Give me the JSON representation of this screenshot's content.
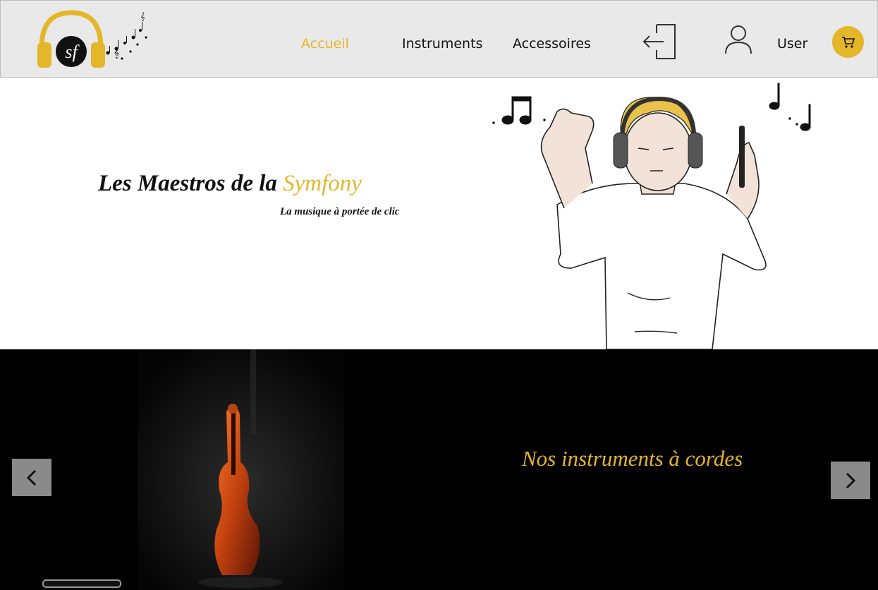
{
  "brand": {
    "logo_text": "sf",
    "logo_icon": "headphones-music-icon"
  },
  "nav": {
    "items": [
      {
        "label": "Accueil",
        "active": true
      },
      {
        "label": "Instruments",
        "active": false
      },
      {
        "label": "Accessoires",
        "active": false
      }
    ],
    "logout_icon": "logout-door-icon",
    "user_icon": "user-icon",
    "user_label": "User",
    "cart_icon": "cart-icon"
  },
  "hero": {
    "title_main": "Les Maestros de la ",
    "title_accent": "Symfony",
    "subtitle": "La musique à portée de clic",
    "illustration": "man-listening-headphones-illustration"
  },
  "carousel": {
    "slide_title": "Nos instruments à cordes",
    "slide_image": "double-bass-photo",
    "prev_icon": "chevron-left-icon",
    "next_icon": "chevron-right-icon"
  },
  "colors": {
    "accent": "#e4b62a",
    "header_bg": "#e9e9e9",
    "carousel_bg": "#000000",
    "arrow_bg": "#8a8a8a"
  }
}
